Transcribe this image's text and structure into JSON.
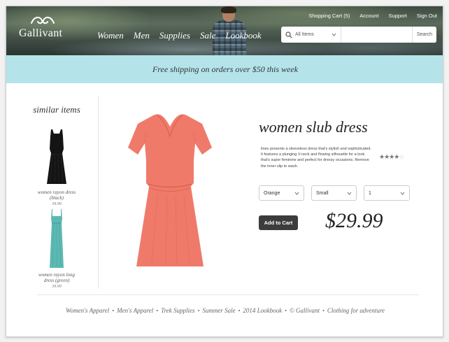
{
  "brand": {
    "name": "Gallivant",
    "logo_icon": "leaf-logo-icon"
  },
  "header": {
    "nav": [
      "Women",
      "Men",
      "Supplies",
      "Sale",
      "Lookbook"
    ],
    "utility": [
      "Shopping Cart (5)",
      "Account",
      "Support",
      "Sign Out"
    ],
    "search": {
      "category": "All Items",
      "placeholder": "",
      "button": "Search",
      "icon": "search-icon"
    }
  },
  "banner": {
    "text": "Free shipping on orders over $50 this week"
  },
  "sidebar": {
    "title": "similar items",
    "items": [
      {
        "name_line1": "women rayon dress",
        "name_line2": "(black)",
        "price": "39.99",
        "color": "#141414"
      },
      {
        "name_line1": "women rayon long",
        "name_line2": "dress (green)",
        "price": "39.99",
        "color": "#5cb8b2"
      }
    ]
  },
  "product": {
    "title": "women slub dress",
    "description": "lines presents a sleeveless dress that's stylish and sophisticated. It features a plunging V-neck and flowing silhouette for a look that's super feminine and perfect for dressy occasions. Remove the inner slip to wash.",
    "rating": 4,
    "rating_max": 5,
    "color_option": "Orange",
    "size_option": "Small",
    "quantity_option": "1",
    "add_to_cart": "Add to Cart",
    "price": "$29.99",
    "dress_color": "#f07a6a"
  },
  "footer": {
    "links": [
      "Women's Apparel",
      "Men's Apparel",
      "Trek Supplies",
      "Summer Sale",
      "2014 Lookbook",
      "© Gallivant",
      "Clothing for adventure"
    ],
    "separator": "•"
  }
}
